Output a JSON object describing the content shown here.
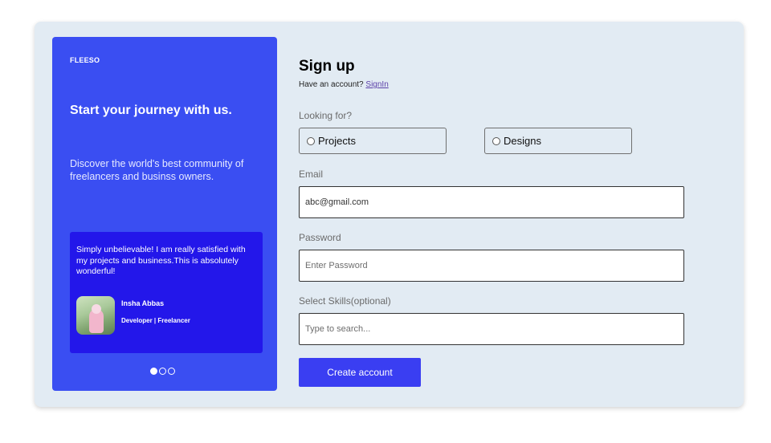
{
  "brand": "FLEESO",
  "hero": {
    "headline": "Start your journey with us.",
    "subtext": "Discover the world's best community of freelancers and businss owners."
  },
  "testimonial": {
    "quote": "Simply unbelievable! I am really satisfied with my projects and business.This is absolutely wonderful!",
    "author": "Insha Abbas",
    "role": "Developer | Freelancer"
  },
  "carousel": {
    "total": 3,
    "active": 0
  },
  "form": {
    "title": "Sign up",
    "have_account": "Have an account?",
    "signin_link": "SignIn",
    "looking_for_label": "Looking for?",
    "options": [
      "Projects",
      "Designs"
    ],
    "email_label": "Email",
    "email_value": "abc@gmail.com",
    "password_label": "Password",
    "password_placeholder": "Enter Password",
    "skills_label": "Select Skills(optional)",
    "skills_placeholder": "Type to search...",
    "submit_label": "Create account"
  },
  "colors": {
    "panel": "#3a4ef2",
    "testimonial_bg": "#2317ea",
    "button": "#3a3ef2",
    "card_bg": "#e2ebf3"
  }
}
